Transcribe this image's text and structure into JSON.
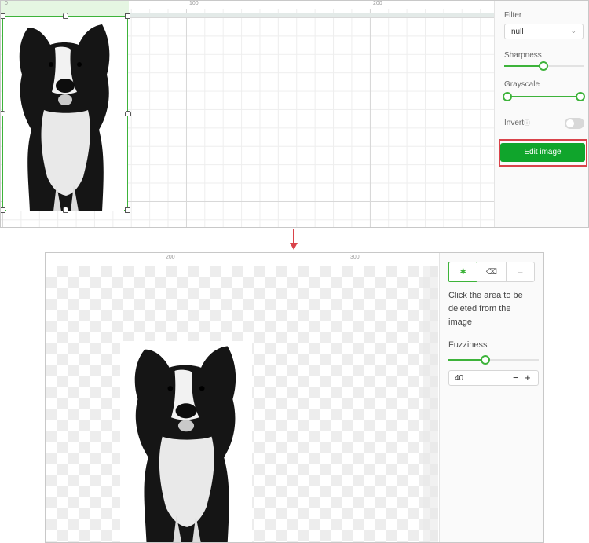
{
  "editor": {
    "ruler_labels": [
      "0",
      "100",
      "200"
    ],
    "sidebar": {
      "filter_label": "Filter",
      "filter_value": "null",
      "sharpness_label": "Sharpness",
      "sharpness_value": 0.48,
      "grayscale_label": "Grayscale",
      "grayscale_range": [
        0,
        1
      ],
      "invert_label": "Invert",
      "invert_on": false,
      "edit_button": "Edit image"
    }
  },
  "image_editor": {
    "ruler_labels": [
      "200",
      "300"
    ],
    "tools": [
      "magic-wand-icon",
      "eraser-icon",
      "crop-icon"
    ],
    "hint": "Click the area to be deleted from the image",
    "fuzziness_label": "Fuzziness",
    "fuzziness_value": "40",
    "fuzziness_level": 0.4
  },
  "colors": {
    "accent": "#3db33a",
    "button": "#10a52c",
    "highlight": "#d9434a"
  }
}
